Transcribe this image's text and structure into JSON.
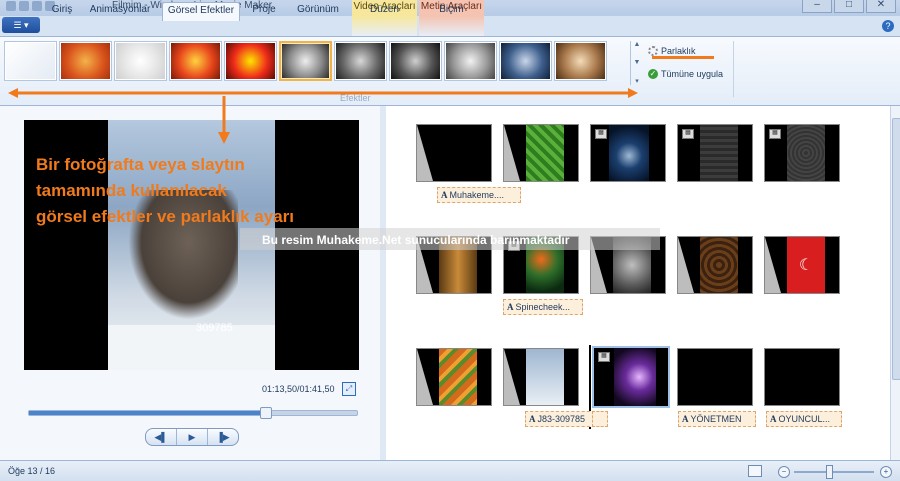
{
  "window": {
    "title": "Filmim - Windows Live Movie Maker"
  },
  "context_tabs": {
    "video": "Video Araçları",
    "metin": "Metin Araçları"
  },
  "tabs": [
    {
      "label": "Giriş"
    },
    {
      "label": "Animasyonlar"
    },
    {
      "label": "Görsel Efektler"
    },
    {
      "label": "Proje"
    },
    {
      "label": "Görünüm"
    },
    {
      "label": "Düzen"
    },
    {
      "label": "Biçim"
    }
  ],
  "ribbon": {
    "group_label": "Efektler",
    "brightness_label": "Parlaklık",
    "apply_all_label": "Tümüne uygula"
  },
  "annotation": {
    "lines": [
      "Bir fotoğrafta veya slaytın",
      "tamamında kullanılacak",
      "görsel efektler ve parlaklık ayarı"
    ]
  },
  "watermark": "Bu resim Muhakeme.Net sunucularında barınmaktadır",
  "preview": {
    "time": "01:13,50/01:41,50",
    "progress": 0.72,
    "overlay_number": "309785"
  },
  "captions": [
    "Muhakeme....",
    "Spinecheek...",
    "J83-309785",
    "YÖNETMEN",
    "OYUNCUL..."
  ],
  "status": {
    "text": "Öğe 13 / 16"
  },
  "colors": {
    "accent": "#f07a1c",
    "ribbon_blue": "#1e395b"
  },
  "icons": [
    "app-menu-icon",
    "help-icon",
    "brightness-icon",
    "apply-all-icon",
    "fullscreen-icon",
    "prev-frame-icon",
    "play-icon",
    "next-frame-icon",
    "zoom-minus-icon",
    "zoom-plus-icon"
  ]
}
